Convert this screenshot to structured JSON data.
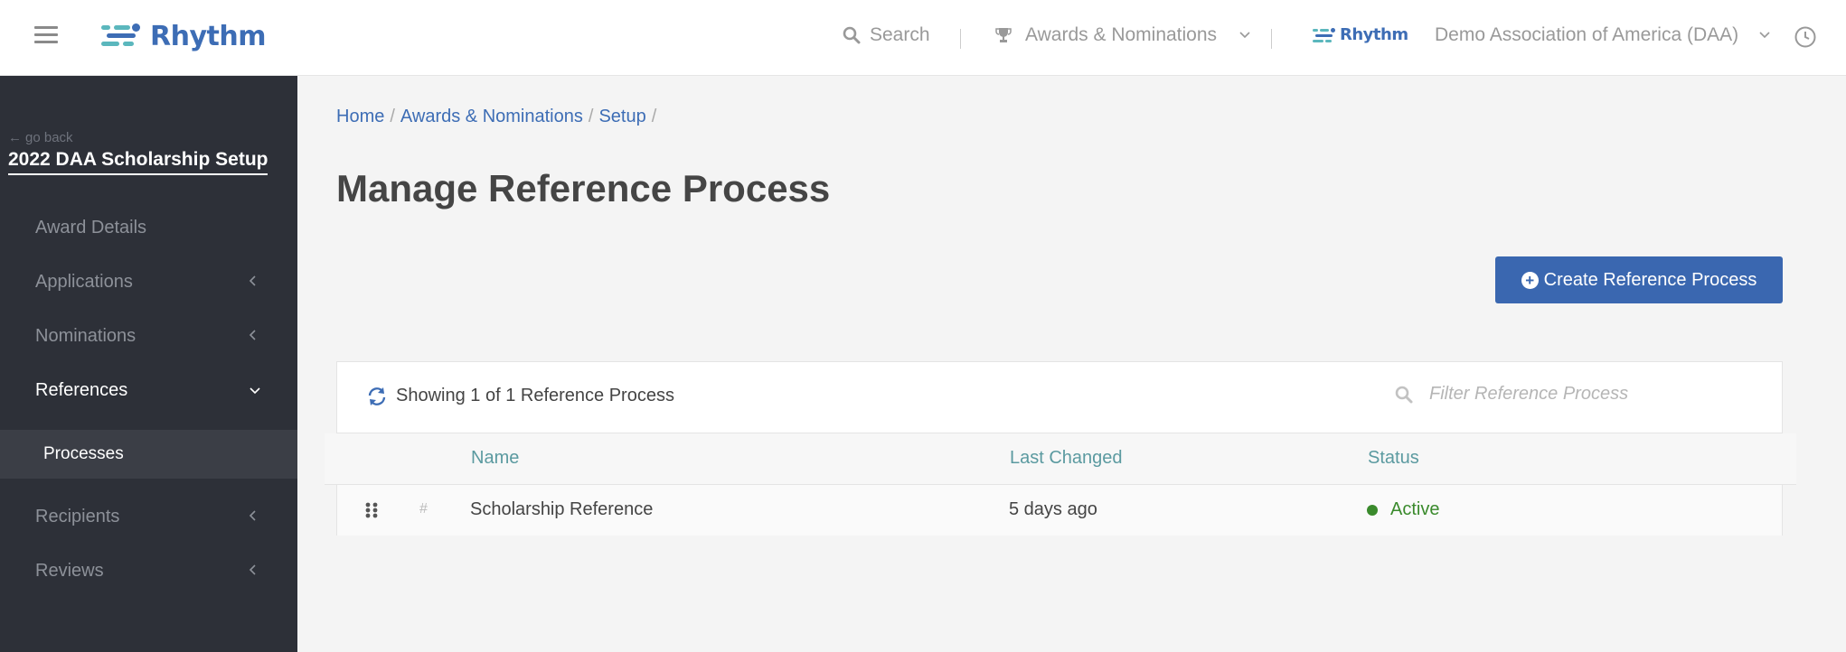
{
  "header": {
    "brand": "Rhythm",
    "search_label": "Search",
    "module_label": "Awards & Nominations",
    "secondary_brand": "Rhythm",
    "organization": "Demo Association of America (DAA)"
  },
  "sidebar": {
    "go_back": "go back",
    "title": "2022 DAA Scholarship Setup",
    "items": [
      {
        "label": "Award Details"
      },
      {
        "label": "Applications"
      },
      {
        "label": "Nominations"
      },
      {
        "label": "References"
      },
      {
        "label": "Processes"
      },
      {
        "label": "Recipients"
      },
      {
        "label": "Reviews"
      }
    ]
  },
  "breadcrumb": [
    "Home",
    "Awards & Nominations",
    "Setup"
  ],
  "page_title": "Manage Reference Process",
  "create_button": "Create Reference Process",
  "table": {
    "showing_text": "Showing 1 of 1 Reference Process",
    "filter_placeholder": "Filter Reference Process",
    "columns": [
      "Name",
      "Last Changed",
      "Status"
    ],
    "rows": [
      {
        "hash": "#",
        "name": "Scholarship Reference",
        "last_changed": "5 days ago",
        "status": "Active"
      }
    ]
  },
  "colors": {
    "brand_blue": "#3d6db5",
    "button_blue": "#3a67b0",
    "sidebar_bg": "#2d3038",
    "header_teal": "#5b9aa0",
    "status_green": "#3a8a2c",
    "logo_teal": "#5bb7bd"
  }
}
